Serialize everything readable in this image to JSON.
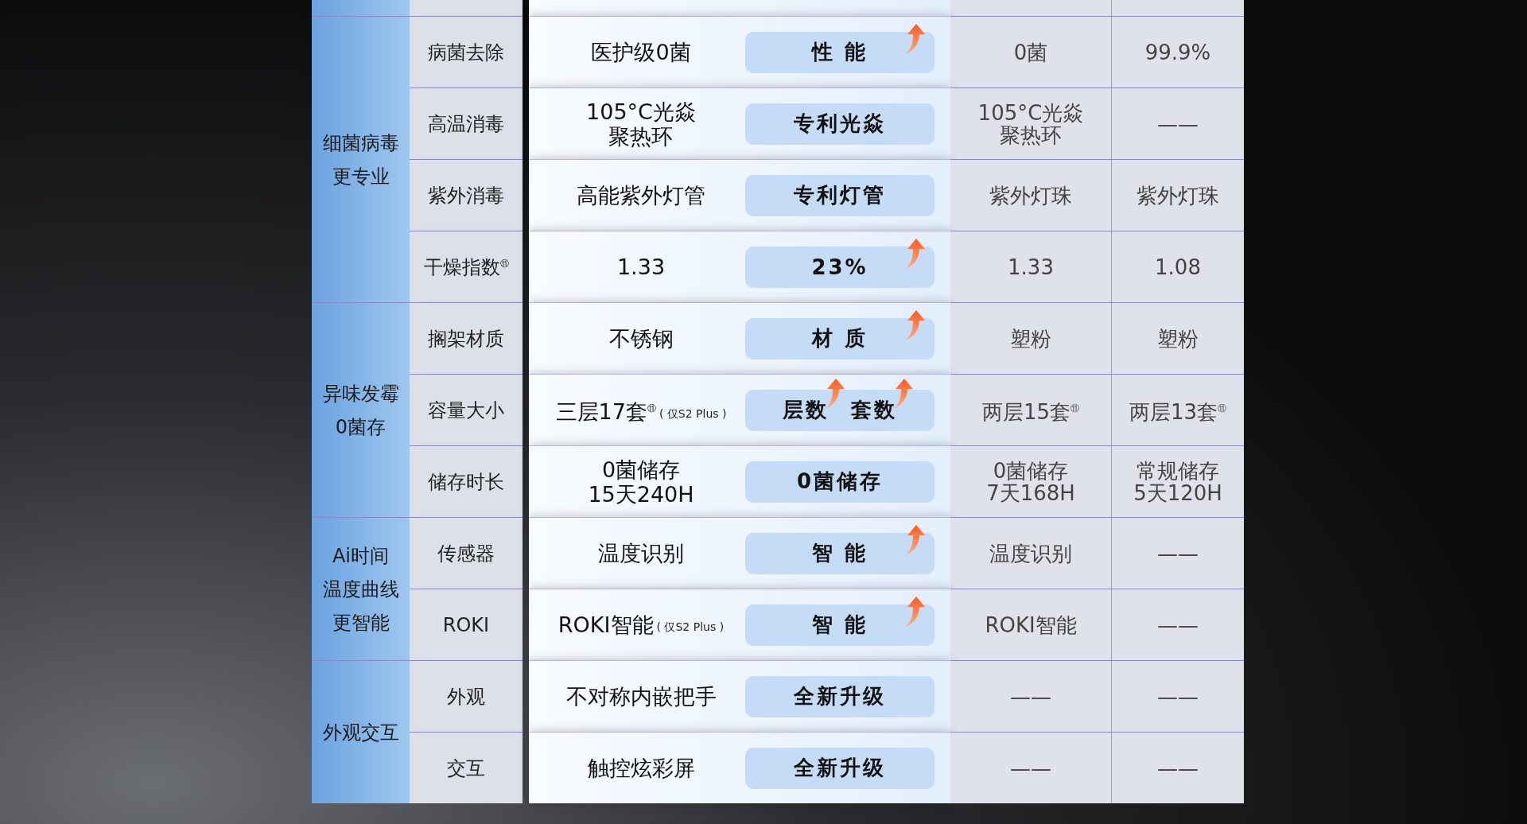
{
  "groups": [
    {
      "label": [
        "细菌病毒",
        "更专业"
      ],
      "rows": [
        {
          "feature": "病菌去除",
          "value": {
            "lines": [
              "医护级0菌"
            ]
          },
          "badge": [
            {
              "text": "性 能",
              "arrow": true
            }
          ],
          "compare": [
            [
              "0菌"
            ],
            [
              "99.9%"
            ]
          ]
        },
        {
          "feature": "高温消毒",
          "value": {
            "lines": [
              "105°C光焱",
              "聚热环"
            ]
          },
          "badge": [
            {
              "text": "专利光焱",
              "arrow": false
            }
          ],
          "compare": [
            [
              "105°C光焱",
              "聚热环"
            ],
            [
              "——"
            ]
          ]
        },
        {
          "feature": "紫外消毒",
          "value": {
            "lines": [
              "高能紫外灯管"
            ]
          },
          "badge": [
            {
              "text": "专利灯管",
              "arrow": false
            }
          ],
          "compare": [
            [
              "紫外灯珠"
            ],
            [
              "紫外灯珠"
            ]
          ]
        },
        {
          "feature": "干燥指数$^{⑪}$",
          "value": {
            "lines": [
              "1.33"
            ]
          },
          "badge": [
            {
              "text": "23%",
              "arrow": true
            }
          ],
          "compare": [
            [
              "1.33"
            ],
            [
              "1.08"
            ]
          ]
        }
      ]
    },
    {
      "label": [
        "异味发霉",
        "0菌存"
      ],
      "rows": [
        {
          "feature": "搁架材质",
          "value": {
            "lines": [
              "不锈钢"
            ]
          },
          "badge": [
            {
              "text": "材 质",
              "arrow": true
            }
          ],
          "compare": [
            [
              "塑粉"
            ],
            [
              "塑粉"
            ]
          ]
        },
        {
          "feature": "容量大小",
          "value": {
            "lines": [
              "三层17套$^{⑪}$"
            ],
            "note": "( 仅S2 Plus )"
          },
          "badge": [
            {
              "text": "层数",
              "arrow": true
            },
            {
              "text": "套数",
              "arrow": true
            }
          ],
          "compare": [
            [
              "两层15套$^{⑪}$"
            ],
            [
              "两层13套$^{⑪}$"
            ]
          ]
        },
        {
          "feature": "储存时长",
          "value": {
            "lines": [
              "0菌储存",
              "15天240H"
            ]
          },
          "badge": [
            {
              "text": "0菌储存",
              "arrow": false
            }
          ],
          "compare": [
            [
              "0菌储存",
              "7天168H"
            ],
            [
              "常规储存",
              "5天120H"
            ]
          ]
        }
      ]
    },
    {
      "label": [
        "Ai时间",
        "温度曲线",
        "更智能"
      ],
      "rows": [
        {
          "feature": "传感器",
          "value": {
            "lines": [
              "温度识别"
            ]
          },
          "badge": [
            {
              "text": "智 能",
              "arrow": true
            }
          ],
          "compare": [
            [
              "温度识别"
            ],
            [
              "——"
            ]
          ]
        },
        {
          "feature": "ROKI",
          "value": {
            "lines": [
              "ROKI智能"
            ],
            "note": "( 仅S2 Plus )"
          },
          "badge": [
            {
              "text": "智 能",
              "arrow": true
            }
          ],
          "compare": [
            [
              "ROKI智能"
            ],
            [
              "——"
            ]
          ]
        }
      ]
    },
    {
      "label": [
        "外观交互"
      ],
      "rows": [
        {
          "feature": "外观",
          "value": {
            "lines": [
              "不对称内嵌把手"
            ]
          },
          "badge": [
            {
              "text": "全新升级",
              "arrow": false
            }
          ],
          "compare": [
            [
              "——"
            ],
            [
              "——"
            ]
          ]
        },
        {
          "feature": "交互",
          "value": {
            "lines": [
              "触控炫彩屏"
            ]
          },
          "badge": [
            {
              "text": "全新升级",
              "arrow": false
            }
          ],
          "compare": [
            [
              "——"
            ],
            [
              "——"
            ]
          ]
        }
      ]
    }
  ]
}
